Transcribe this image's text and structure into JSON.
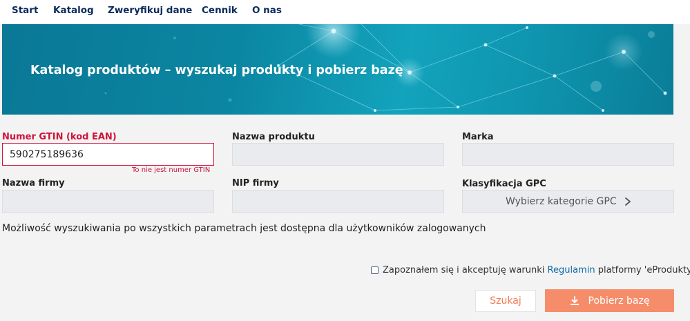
{
  "nav": {
    "items": [
      {
        "label": "Start"
      },
      {
        "label": "Katalog"
      },
      {
        "label": "Zweryfikuj dane"
      },
      {
        "label": "Cennik"
      },
      {
        "label": "O nas"
      }
    ]
  },
  "hero": {
    "title": "Katalog produktów – wyszukaj produkty i pobierz bazę"
  },
  "form": {
    "gtin": {
      "label": "Numer GTIN (kod EAN)",
      "value": "590275189636",
      "error": "To nie jest numer GTIN"
    },
    "product_name": {
      "label": "Nazwa produktu",
      "value": ""
    },
    "brand": {
      "label": "Marka",
      "value": ""
    },
    "company_name": {
      "label": "Nazwa firmy",
      "value": ""
    },
    "nip": {
      "label": "NIP firmy",
      "value": ""
    },
    "gpc": {
      "label": "Klasyfikacja GPC",
      "placeholder": "Wybierz kategorie GPC"
    }
  },
  "info_text": "Możliwość wyszukiwania po wszystkich parametrach jest dostępna dla użytkowników zalogowanych",
  "terms": {
    "text_before": "Zapoznałem się i akceptuję warunki",
    "link": "Regulamin",
    "text_after": "platformy 'eProdukty'",
    "checked": false
  },
  "buttons": {
    "search": "Szukaj",
    "download": "Pobierz bazę"
  },
  "colors": {
    "nav_text": "#0b2a5c",
    "error": "#d0123a",
    "accent": "#f58d6a",
    "link": "#0d6aa8"
  }
}
